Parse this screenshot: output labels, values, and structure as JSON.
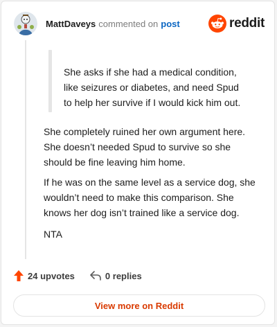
{
  "header": {
    "username": "MattDaveys",
    "action_text": "commented on",
    "post_link": "post",
    "brand_name": "reddit",
    "avatar_icon": "snoo-avatar-icon",
    "brand_icon": "reddit-logo-icon"
  },
  "quote": {
    "lines": [
      "She asks if she had a medical condition,",
      "like seizures or diabetes, and need Spud",
      "to help her survive if I would kick him out."
    ]
  },
  "comment": {
    "paragraphs": [
      {
        "lines": [
          "She completely ruined her own argument here.",
          "She doesn’t needed Spud to survive so she",
          "should be fine leaving him home."
        ]
      },
      {
        "lines": [
          "If he was on the same level as a service dog, she",
          "wouldn’t need to make this comparison. She",
          "knows her dog isn’t trained like a service dog."
        ]
      },
      {
        "lines": [
          "NTA"
        ]
      }
    ]
  },
  "actions": {
    "upvotes_label": "24 upvotes",
    "replies_label": "0 replies",
    "upvote_icon": "upvote-arrow-icon",
    "reply_icon": "reply-arrow-icon"
  },
  "footer": {
    "view_more_label": "View more on Reddit"
  },
  "colors": {
    "brand_orange": "#ff4500",
    "link_blue": "#0a66c2",
    "view_more_text": "#d93a00",
    "muted_text": "#7c7c7c"
  }
}
